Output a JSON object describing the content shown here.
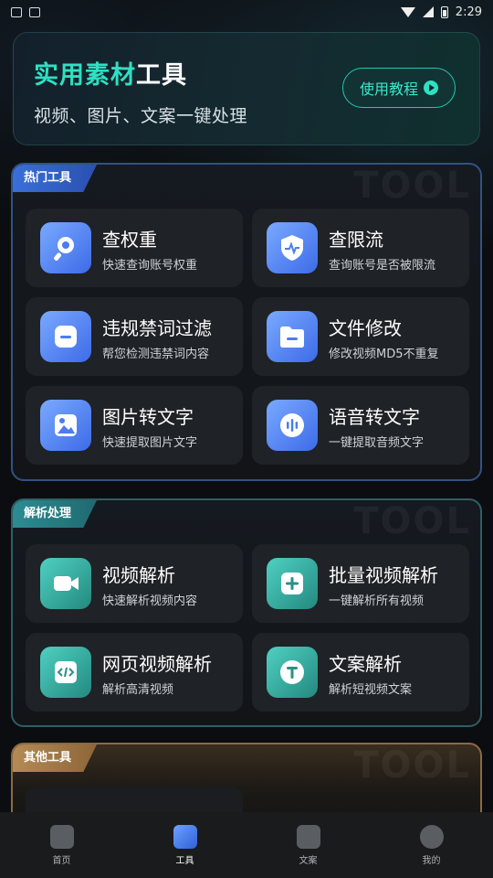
{
  "status_bar": {
    "time": "2:29"
  },
  "header": {
    "title_accent": "实用素材",
    "title_rest": "工具",
    "subtitle": "视频、图片、文案一键处理",
    "tutorial_button": "使用教程"
  },
  "sections": [
    {
      "label": "热门工具",
      "watermark": "TOOL",
      "tools": [
        {
          "name": "查权重",
          "desc": "快速查询账号权重",
          "icon": "search-icon"
        },
        {
          "name": "查限流",
          "desc": "查询账号是否被限流",
          "icon": "shield-icon"
        },
        {
          "name": "违规禁词过滤",
          "desc": "帮您检测违禁词内容",
          "icon": "filter-icon"
        },
        {
          "name": "文件修改",
          "desc": "修改视频MD5不重复",
          "icon": "folder-icon"
        },
        {
          "name": "图片转文字",
          "desc": "快速提取图片文字",
          "icon": "image-icon"
        },
        {
          "name": "语音转文字",
          "desc": "一键提取音频文字",
          "icon": "audio-icon"
        }
      ]
    },
    {
      "label": "解析处理",
      "watermark": "TOOL",
      "tools": [
        {
          "name": "视频解析",
          "desc": "快速解析视频内容",
          "icon": "video-icon"
        },
        {
          "name": "批量视频解析",
          "desc": "一键解析所有视频",
          "icon": "plus-icon"
        },
        {
          "name": "网页视频解析",
          "desc": "解析高清视频",
          "icon": "code-icon"
        },
        {
          "name": "文案解析",
          "desc": "解析短视频文案",
          "icon": "text-icon"
        }
      ]
    },
    {
      "label": "其他工具",
      "watermark": "TOOL"
    }
  ],
  "bottom_nav": [
    {
      "label": "首页",
      "icon": "home-icon",
      "active": false
    },
    {
      "label": "工具",
      "icon": "tools-icon",
      "active": true
    },
    {
      "label": "文案",
      "icon": "document-icon",
      "active": false
    },
    {
      "label": "我的",
      "icon": "profile-icon",
      "active": false
    }
  ],
  "colors": {
    "accent_teal": "#2fe0c2",
    "section_blue": "#3a6fd8",
    "section_teal": "#2c8c92",
    "section_gold": "#b48a55"
  }
}
